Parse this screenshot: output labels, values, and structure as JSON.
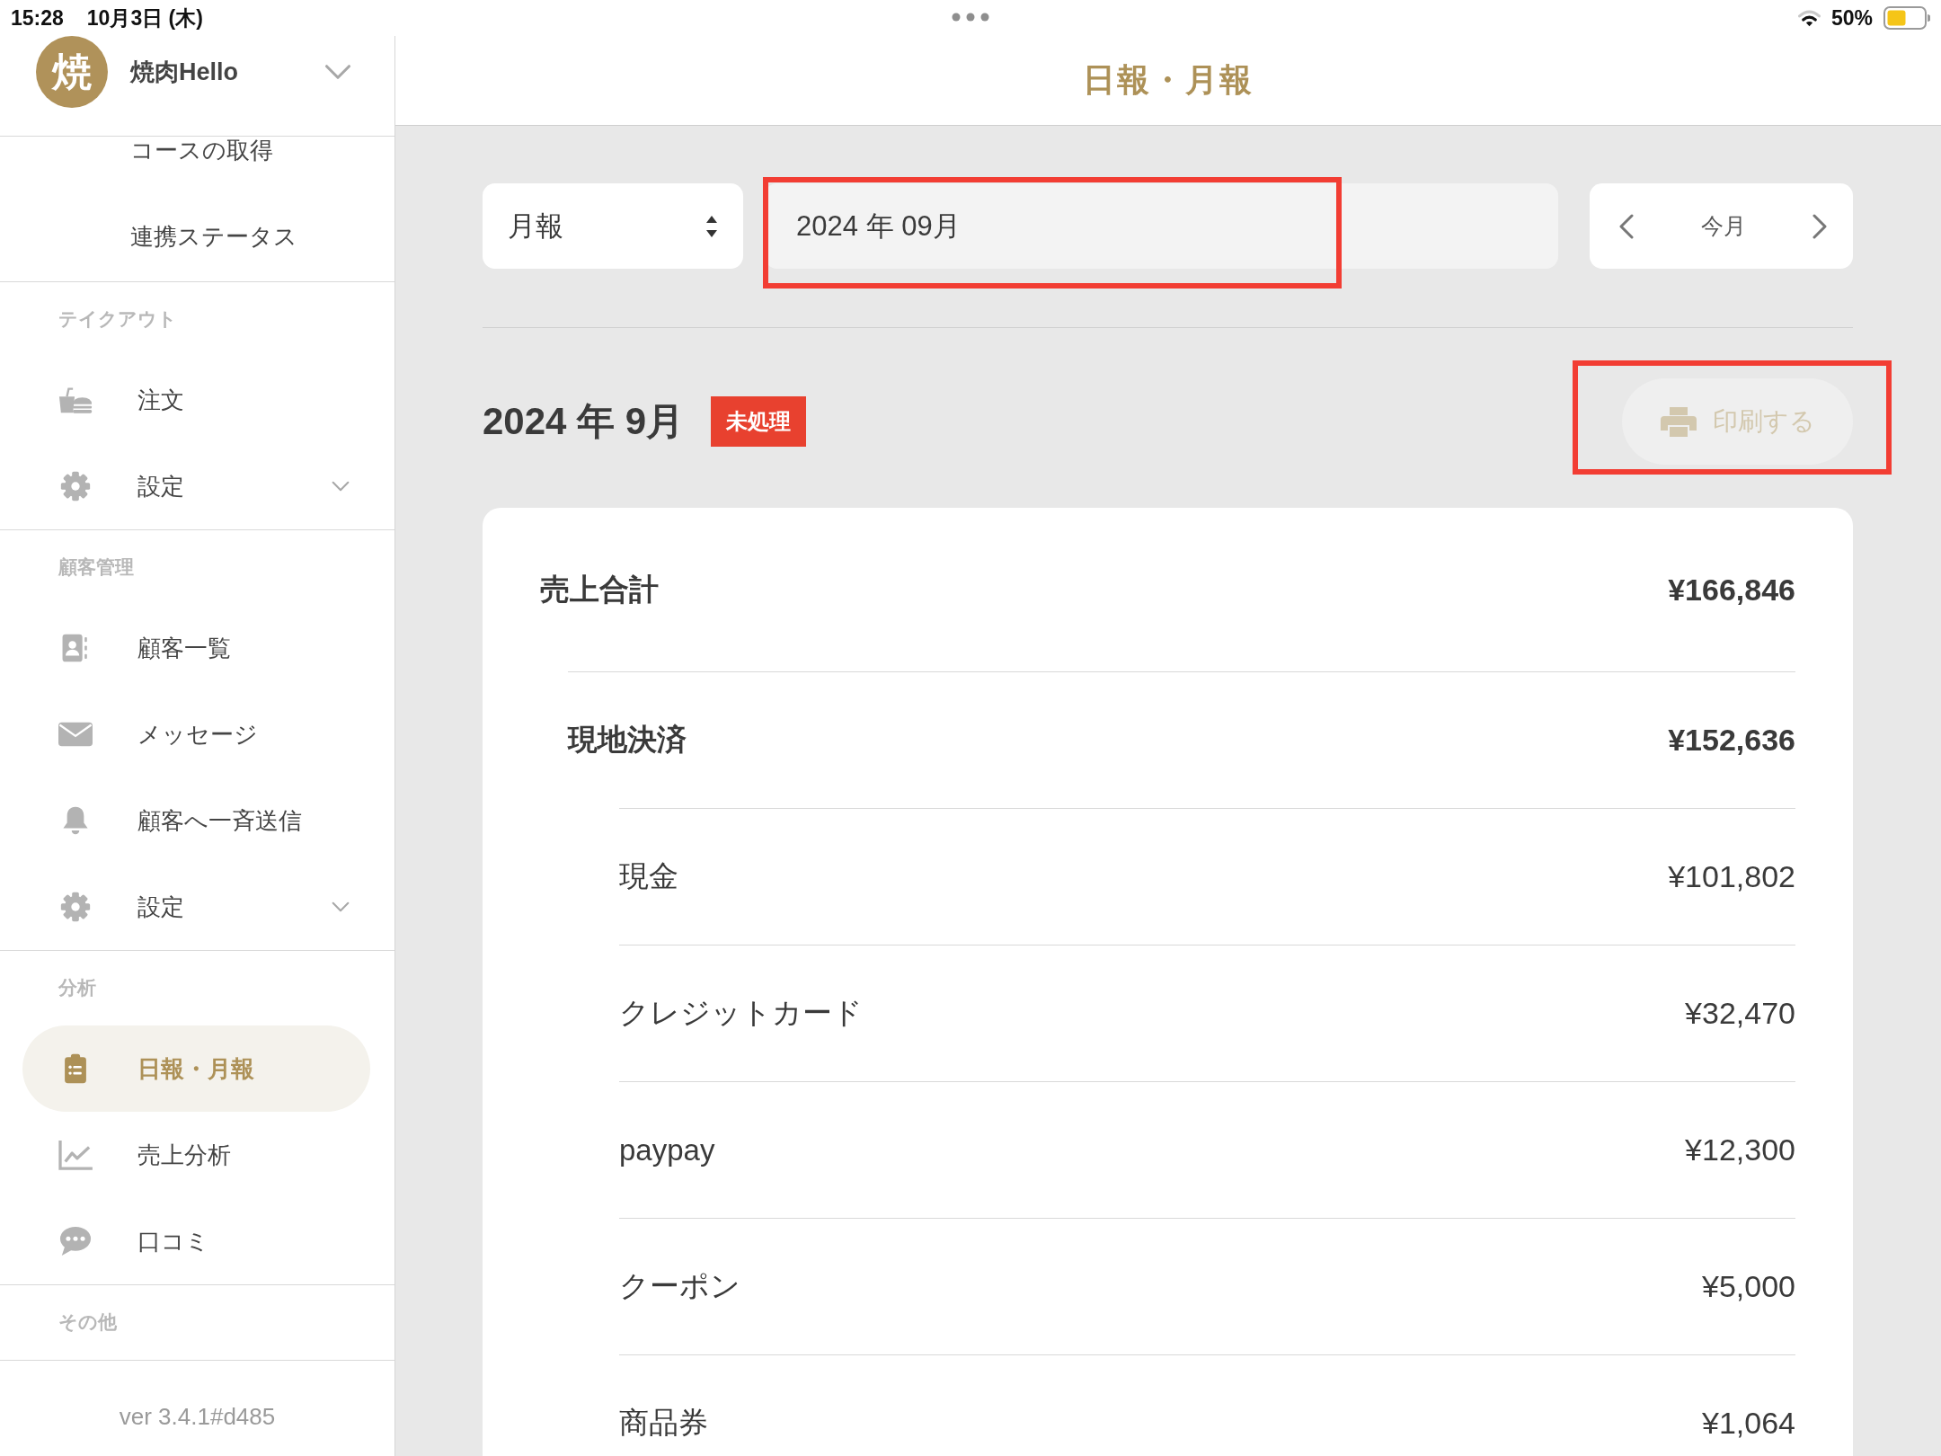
{
  "status_bar": {
    "time": "15:28",
    "date": "10月3日 (木)",
    "battery": "50%"
  },
  "sidebar": {
    "store": {
      "avatar": "焼",
      "name": "焼肉Hello"
    },
    "sub_items": [
      {
        "label": "コースの取得",
        "selected": false
      },
      {
        "label": "連携ステータス",
        "selected": false
      }
    ],
    "sections": [
      {
        "title": "テイクアウト",
        "items": [
          {
            "kind": "orders",
            "label": "注文",
            "expandable": false,
            "selected": false
          },
          {
            "kind": "settings",
            "label": "設定",
            "expandable": true,
            "selected": false
          }
        ]
      },
      {
        "title": "顧客管理",
        "items": [
          {
            "kind": "customers",
            "label": "顧客一覧",
            "expandable": false,
            "selected": false
          },
          {
            "kind": "messages",
            "label": "メッセージ",
            "expandable": false,
            "selected": false
          },
          {
            "kind": "broadcast",
            "label": "顧客へ一斉送信",
            "expandable": false,
            "selected": false
          },
          {
            "kind": "settings",
            "label": "設定",
            "expandable": true,
            "selected": false
          }
        ]
      },
      {
        "title": "分析",
        "items": [
          {
            "kind": "reports",
            "label": "日報・月報",
            "expandable": false,
            "selected": true
          },
          {
            "kind": "analytics",
            "label": "売上分析",
            "expandable": false,
            "selected": false
          },
          {
            "kind": "reviews",
            "label": "口コミ",
            "expandable": false,
            "selected": false
          }
        ]
      },
      {
        "title": "その他"
      }
    ],
    "version": "ver 3.4.1#d485"
  },
  "main": {
    "title": "日報・月報",
    "controls": {
      "period": {
        "value": "月報"
      },
      "date": {
        "value": "2024 年 09月",
        "highlighted": true
      },
      "nav": {
        "label": "今月"
      }
    },
    "report": {
      "title": "2024 年 9月",
      "status": "未処理",
      "print_button": {
        "label": "印刷する",
        "disabled": true,
        "highlighted": true
      },
      "rows": [
        {
          "label": "売上合計",
          "amount": "¥166,846",
          "children": [
            {
              "label": "現地決済",
              "amount": "¥152,636",
              "children": [
                {
                  "label": "現金",
                  "amount": "¥101,802"
                },
                {
                  "label": "クレジットカード",
                  "amount": "¥32,470"
                },
                {
                  "label": "paypay",
                  "amount": "¥12,300"
                },
                {
                  "label": "クーポン",
                  "amount": "¥5,000"
                },
                {
                  "label": "商品券",
                  "amount": "¥1,064"
                }
              ]
            }
          ]
        }
      ]
    }
  }
}
